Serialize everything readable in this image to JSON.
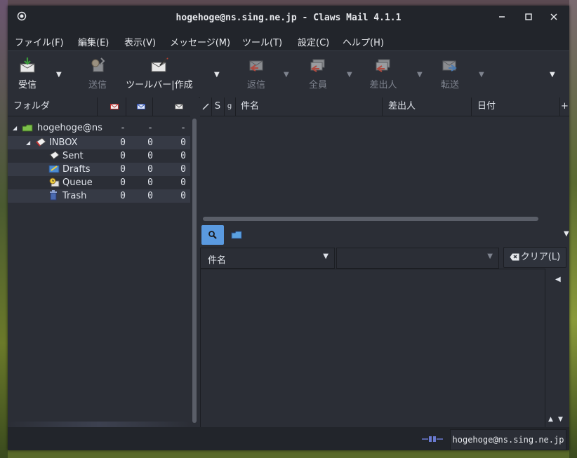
{
  "window": {
    "title": "hogehoge@ns.sing.ne.jp - Claws Mail 4.1.1"
  },
  "menu": [
    "ファイル(F)",
    "編集(E)",
    "表示(V)",
    "メッセージ(M)",
    "ツール(T)",
    "設定(C)",
    "ヘルプ(H)"
  ],
  "toolbar": {
    "receive": "受信",
    "send": "送信",
    "compose": "ツールバー|作成",
    "reply": "返信",
    "reply_all": "全員",
    "reply_sender": "差出人",
    "forward": "転送"
  },
  "folder_pane": {
    "header": "フォルダ",
    "rows": [
      {
        "name": "hogehoge@ns",
        "new": "-",
        "unread": "-",
        "total": "-"
      },
      {
        "name": "INBOX",
        "new": "0",
        "unread": "0",
        "total": "0"
      },
      {
        "name": "Sent",
        "new": "0",
        "unread": "0",
        "total": "0"
      },
      {
        "name": "Drafts",
        "new": "0",
        "unread": "0",
        "total": "0"
      },
      {
        "name": "Queue",
        "new": "0",
        "unread": "0",
        "total": "0"
      },
      {
        "name": "Trash",
        "new": "0",
        "unread": "0",
        "total": "0"
      }
    ]
  },
  "message_list": {
    "columns": {
      "status": "S",
      "attach": "g",
      "subject": "件名",
      "from": "差出人",
      "date": "日付"
    }
  },
  "quick_search": {
    "type": "件名",
    "value": "",
    "clear": "クリア(L)"
  },
  "status": {
    "account": "hogehoge@ns.sing.ne.jp"
  },
  "colors": {
    "accent": "#5a9ae0",
    "window_bg": "#2b2e36",
    "title_bg": "#22252b"
  }
}
